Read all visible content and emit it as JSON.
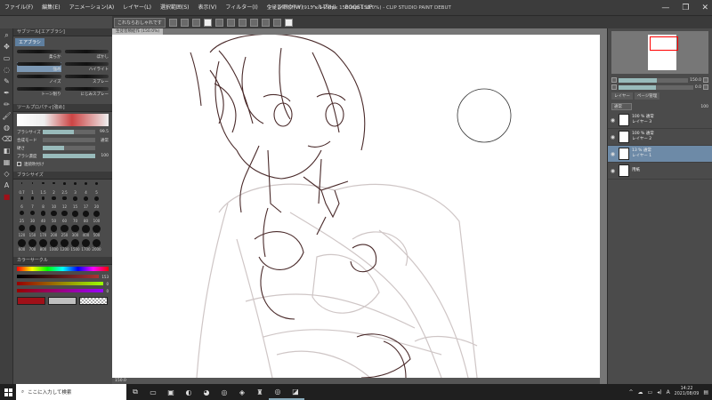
{
  "menubar": {
    "items": [
      "ファイル(F)",
      "編集(E)",
      "アニメーション(A)",
      "レイヤー(L)",
      "選択範囲(S)",
      "表示(V)",
      "フィルター(I)",
      "ウィンドウ(W)",
      "ヘルプ(H)",
      "BOOST UP"
    ],
    "title": "生徒皆類絵作 * (915 x 1456px 1500dpi 150.0%) - CLIP STUDIO PAINT DEBUT",
    "window_buttons": [
      "—",
      "❐",
      "✕"
    ]
  },
  "command_bar": {
    "label": "これならおしゃれです"
  },
  "tool_strip": {
    "icons": [
      "magnifier-icon",
      "move-icon",
      "select-icon",
      "lasso-icon",
      "eyedropper-icon",
      "pen-icon",
      "pencil-icon",
      "brush-icon",
      "airbrush-icon",
      "eraser-icon",
      "fill-icon",
      "gradient-icon",
      "figure-icon",
      "text-icon",
      "color-icon"
    ]
  },
  "subtool": {
    "header": "サブツール[エアブラシ]",
    "tab": "エアブラシ",
    "brushes": [
      {
        "label": "柔らか",
        "selected": false
      },
      {
        "label": "ぼかし",
        "selected": false
      },
      {
        "label": "強め",
        "selected": true
      },
      {
        "label": "ハイライト",
        "selected": false
      },
      {
        "label": "ノイズ",
        "selected": false
      },
      {
        "label": "スプレー",
        "selected": false
      },
      {
        "label": "トーン削り",
        "selected": false
      },
      {
        "label": "にじみスプレー",
        "selected": false
      }
    ]
  },
  "tool_property": {
    "header": "ツールプロパティ[強め]",
    "rows": [
      {
        "label": "ブラシサイズ",
        "value": "99.5",
        "fill": 0.6
      },
      {
        "label": "合成モード",
        "value": "通常",
        "fill": 0.0
      },
      {
        "label": "硬さ",
        "value": "",
        "fill": 0.4
      },
      {
        "label": "ブラシ濃度",
        "value": "100",
        "fill": 1.0
      }
    ],
    "option": "連続吹付け"
  },
  "brush_size": {
    "header": "ブラシサイズ",
    "sizes": [
      "0.7",
      "1",
      "1.5",
      "2",
      "2.5",
      "3",
      "4",
      "5",
      "6",
      "7",
      "8",
      "10",
      "12",
      "15",
      "17",
      "20",
      "25",
      "30",
      "40",
      "50",
      "60",
      "70",
      "80",
      "100",
      "120",
      "150",
      "170",
      "200",
      "250",
      "300",
      "400",
      "500",
      "600",
      "700",
      "800",
      "1000",
      "1200",
      "1500",
      "1700",
      "2000"
    ]
  },
  "color": {
    "header": "カラーサークル",
    "r_value": "153",
    "g_value": "0",
    "b_value": "0",
    "main_color": "#a01018",
    "sub_color": "#bfbfbf"
  },
  "canvas": {
    "tab": "生徒皆類絵作 (150.0%)",
    "status": "150.0"
  },
  "navigator": {
    "zoom": "150.0",
    "angle": "0.0"
  },
  "layers": {
    "tabs": [
      "レイヤー",
      "ページ管理"
    ],
    "blend_mode": "通常",
    "opacity": "100",
    "items": [
      {
        "mode": "100 % 通常",
        "name": "レイヤー 3",
        "active": false,
        "visible": true
      },
      {
        "mode": "100 % 通常",
        "name": "レイヤー 2",
        "active": false,
        "visible": true
      },
      {
        "mode": "13 % 通常",
        "name": "レイヤー 1",
        "active": true,
        "visible": true
      },
      {
        "mode": "",
        "name": "用紙",
        "active": false,
        "visible": true
      }
    ]
  },
  "taskbar": {
    "search_placeholder": "ここに入力して検索",
    "apps": [
      "task-view-icon",
      "file-explorer-icon",
      "store-icon",
      "discord-icon",
      "edge-icon",
      "chrome-icon",
      "app-icon",
      "game-icon",
      "chrome-icon-2",
      "clip-studio-icon"
    ],
    "tray_text": "A",
    "time": "14:22",
    "date": "2021/08/09"
  }
}
